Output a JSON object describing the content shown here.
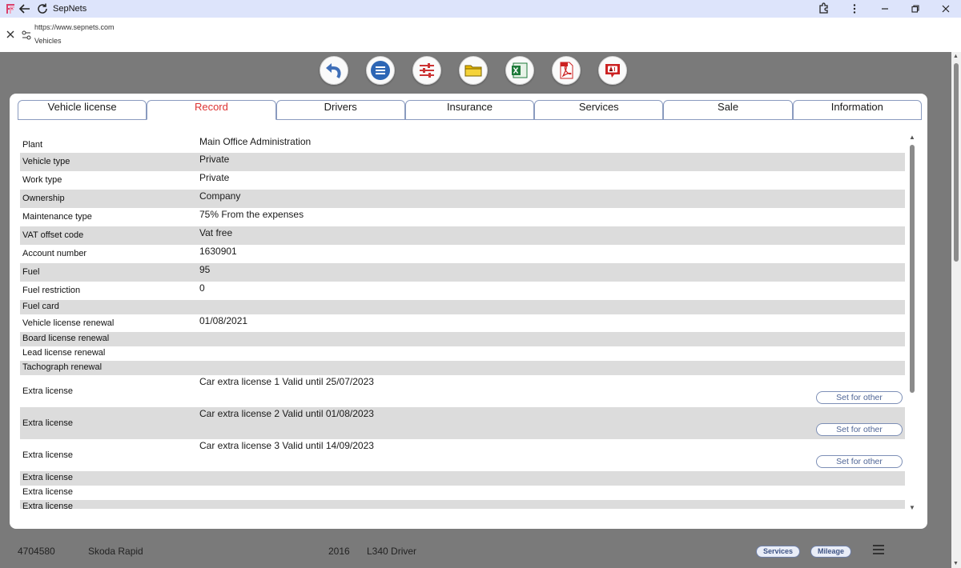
{
  "window": {
    "title": "SepNets",
    "url": "https://www.sepnets.com",
    "page_name": "Vehicles"
  },
  "tabs": [
    {
      "label": "Vehicle license",
      "active": false
    },
    {
      "label": "Record",
      "active": true
    },
    {
      "label": "Drivers",
      "active": false
    },
    {
      "label": "Insurance",
      "active": false
    },
    {
      "label": "Services",
      "active": false
    },
    {
      "label": "Sale",
      "active": false
    },
    {
      "label": "Information",
      "active": false
    }
  ],
  "toolbar": {
    "icons": [
      "back-icon",
      "list-icon",
      "settings-sliders-icon",
      "folder-icon",
      "excel-icon",
      "pdf-icon",
      "ai-icon"
    ]
  },
  "record_rows": [
    {
      "label": "Plant",
      "value": "Main Office Administration"
    },
    {
      "label": "Vehicle type",
      "value": "Private"
    },
    {
      "label": "Work type",
      "value": "Private"
    },
    {
      "label": "Ownership",
      "value": "Company"
    },
    {
      "label": "Maintenance type",
      "value": "75% From the expenses"
    },
    {
      "label": "VAT offset code",
      "value": "Vat free"
    },
    {
      "label": "Account number",
      "value": "1630901"
    },
    {
      "label": "Fuel",
      "value": "95"
    },
    {
      "label": "Fuel restriction",
      "value": "0"
    },
    {
      "label": "Fuel card",
      "value": ""
    },
    {
      "label": "Vehicle license renewal",
      "value": "01/08/2021"
    },
    {
      "label": "Board license renewal",
      "value": ""
    },
    {
      "label": "Lead license renewal",
      "value": ""
    },
    {
      "label": "Tachograph renewal",
      "value": ""
    },
    {
      "label": "Extra license",
      "value": "Car extra license 1 Valid until 25/07/2023",
      "button": "Set for other"
    },
    {
      "label": "Extra license",
      "value": "Car extra license 2 Valid until 01/08/2023",
      "button": "Set for other"
    },
    {
      "label": "Extra license",
      "value": "Car extra license 3 Valid until 14/09/2023",
      "button": "Set for other"
    },
    {
      "label": "Extra license",
      "value": ""
    },
    {
      "label": "Extra license",
      "value": ""
    },
    {
      "label": "Extra license",
      "value": ""
    }
  ],
  "background_row": {
    "id": "4704580",
    "model": "Skoda Rapid",
    "year": "2016",
    "driver": "L340 Driver",
    "services_label": "Services",
    "mileage_label": "Mileage"
  },
  "colors": {
    "active_tab": "#dd3333",
    "button_text": "#4f6596",
    "alt_row": "#dcdcdc",
    "titlebar": "#dde4fb"
  }
}
